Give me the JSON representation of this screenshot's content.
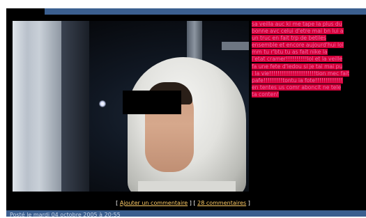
{
  "post": {
    "message_lines": [
      "sa veilla auc ki me tape la plus du",
      "bonne avc celui d'etre mai bn lui a",
      "un truc en fait trp de betiles",
      "ensemble et encore aujourd'hui lol",
      "mm tu r'btu tu as fait nike la",
      "l'etat cramer!!!!!!!!!!lol et la veille",
      "fa une fete d'ledou si je tai mai pu",
      "i la vie!!!!!!!!!!!!!!!!!!!!!!tion mec fait",
      "pafe!!!!!!!!!tontu ia fote!!!!!!!!!!!!!",
      "en tentes us comr aboncit ne tele",
      "ta conten!"
    ],
    "links": {
      "open_bracket": "[",
      "add_comment": "Ajouter un commentaire",
      "separator": "] [",
      "comments": "28 commentaires",
      "close_bracket": "]"
    },
    "posted_text": "Posté le mardi 04 octobre 2005 à 20:55"
  },
  "colors": {
    "header_bar": "#3b5f8f",
    "text_highlight": "#d6003a",
    "text_color": "#f06fa8",
    "link_color": "#ffcc66"
  }
}
